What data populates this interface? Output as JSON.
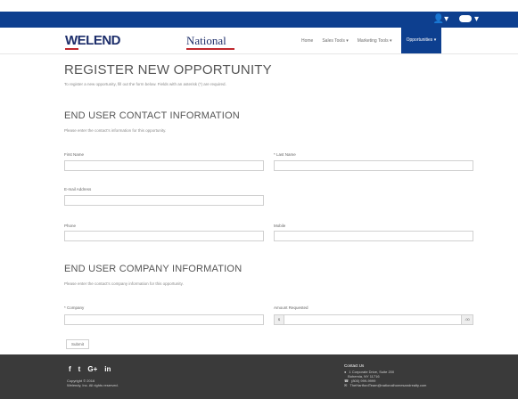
{
  "topbar": {
    "icons": [
      "user-icon",
      "settings-icon"
    ],
    "dropdown_caret": "▾"
  },
  "brand": {
    "logo_text": "WELEND",
    "partner_text": "National"
  },
  "nav": {
    "items": [
      "Home",
      "Sales Tools ▾",
      "Marketing Tools ▾",
      "Opportunities ▾"
    ]
  },
  "page": {
    "title": "REGISTER NEW OPPORTUNITY",
    "subtitle": "To register a new opportunity, fill out the form below. Fields with an asterisk (*) are required."
  },
  "contact_section": {
    "title": "END USER CONTACT INFORMATION",
    "subtitle": "Please enter the contact's information for this opportunity."
  },
  "fields": {
    "first_name": {
      "label": "First Name",
      "value": ""
    },
    "last_name": {
      "label": "* Last Name",
      "value": ""
    },
    "email": {
      "label": "E-mail Address",
      "value": ""
    },
    "phone": {
      "label": "Phone",
      "value": ""
    },
    "mobile": {
      "label": "Mobile",
      "value": ""
    }
  },
  "company_section": {
    "title": "END USER COMPANY INFORMATION",
    "subtitle": "Please enter the contact's company information for this opportunity."
  },
  "company_fields": {
    "company": {
      "label": "* Company",
      "value": ""
    },
    "amount": {
      "label": "Amount Requested",
      "prefix": "$",
      "suffix": ".00",
      "value": ""
    }
  },
  "actions": {
    "submit_label": "Submit"
  },
  "footer": {
    "social": [
      "f",
      "t",
      "G+",
      "in"
    ],
    "copyright": "Copyright © 2016",
    "rights": "Welendy, Inc. All rights reserved.",
    "contact": {
      "title": "Contact Us",
      "address1": "1 Corporate Drive, Suite 200",
      "address2": "Bohemia, NY 11716",
      "phone": "(800) 999-9999",
      "email": "TheHartfordTeam@nationalhomesandrealty.com"
    }
  }
}
